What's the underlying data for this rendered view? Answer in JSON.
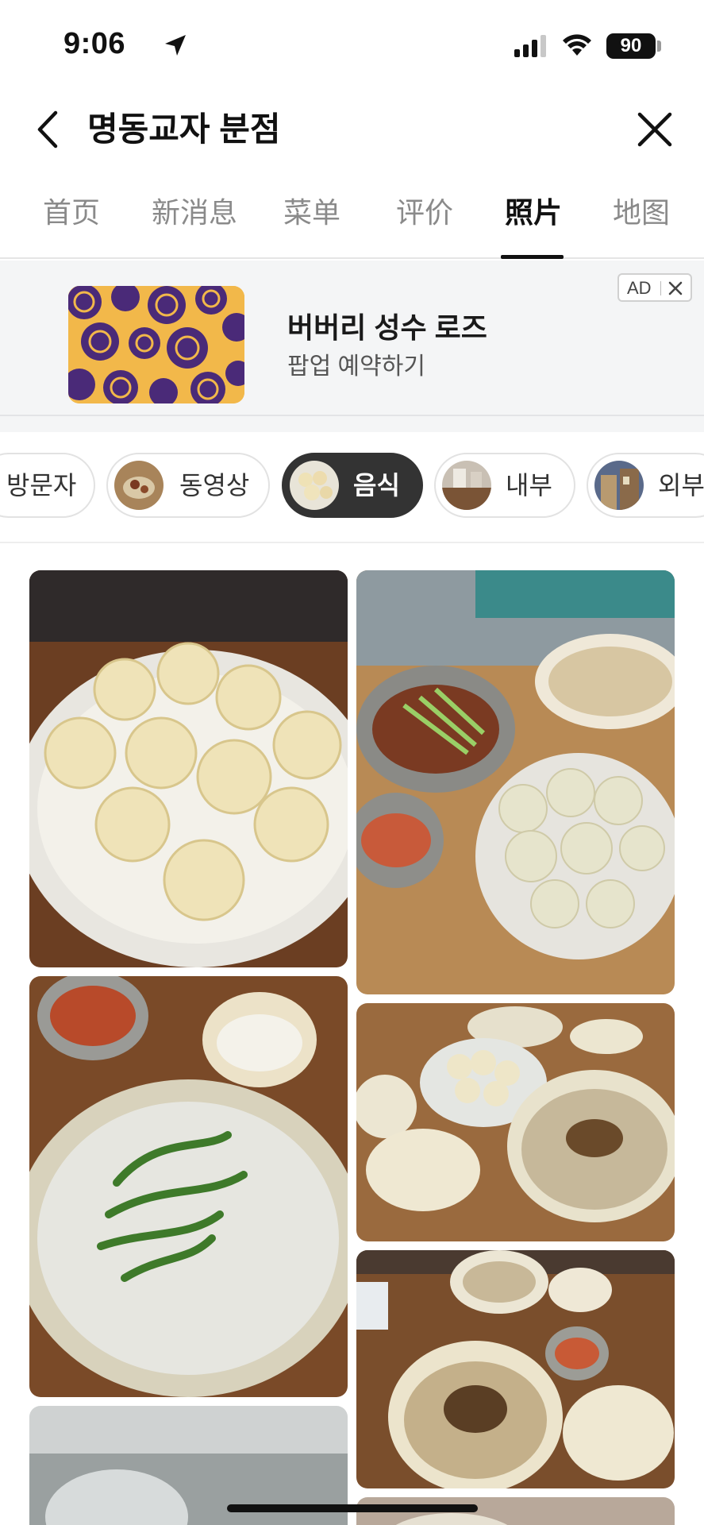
{
  "status_bar": {
    "time": "9:06",
    "battery": "90"
  },
  "header": {
    "title": "명동교자 분점",
    "back_icon": "chevron-left-icon",
    "close_icon": "close-icon"
  },
  "tabs": [
    {
      "label": "首页",
      "active": false
    },
    {
      "label": "新消息",
      "active": false
    },
    {
      "label": "菜单",
      "active": false
    },
    {
      "label": "评价",
      "active": false
    },
    {
      "label": "照片",
      "active": true
    },
    {
      "label": "地图",
      "active": false
    }
  ],
  "ad": {
    "title": "버버리 성수 로즈",
    "subtitle": "팝업 예약하기",
    "badge": "AD",
    "colors": {
      "image_bg": "#f2b84a",
      "image_pattern": "#4a2a78"
    }
  },
  "filter_chips": [
    {
      "label": "방문자",
      "active": false,
      "has_thumb": false
    },
    {
      "label": "동영상",
      "active": false,
      "has_thumb": true
    },
    {
      "label": "음식",
      "active": true,
      "has_thumb": true
    },
    {
      "label": "내부",
      "active": false,
      "has_thumb": true
    },
    {
      "label": "외부",
      "active": false,
      "has_thumb": true
    }
  ],
  "colors": {
    "accent": "#111111",
    "inactive_tab": "#8a8a8a",
    "chip_active_bg": "#333333",
    "ad_bg": "#f4f5f6"
  }
}
